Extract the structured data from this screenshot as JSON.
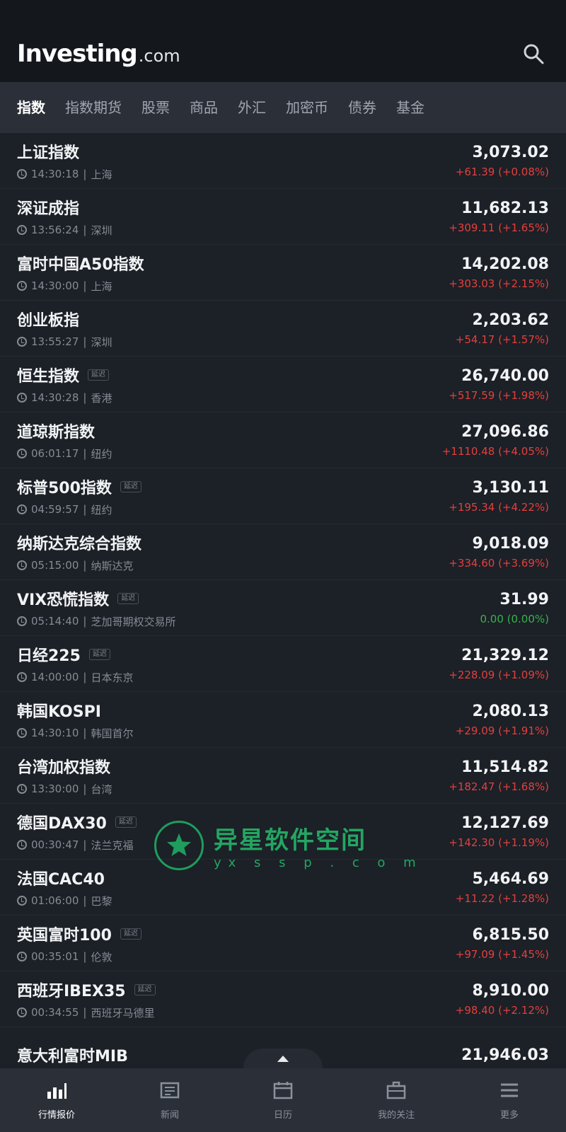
{
  "header": {
    "logo_main": "Investing",
    "logo_suffix": ".com"
  },
  "tabs": [
    {
      "label": "指数",
      "active": true
    },
    {
      "label": "指数期货",
      "active": false
    },
    {
      "label": "股票",
      "active": false
    },
    {
      "label": "商品",
      "active": false
    },
    {
      "label": "外汇",
      "active": false
    },
    {
      "label": "加密币",
      "active": false
    },
    {
      "label": "债券",
      "active": false
    },
    {
      "label": "基金",
      "active": false
    }
  ],
  "quotes": [
    {
      "name": "上证指数",
      "badge": "",
      "time": "14:30:18",
      "exchange": "上海",
      "price": "3,073.02",
      "change": "+61.39 (+0.08%)",
      "direction": "up"
    },
    {
      "name": "深证成指",
      "badge": "",
      "time": "13:56:24",
      "exchange": "深圳",
      "price": "11,682.13",
      "change": "+309.11 (+1.65%)",
      "direction": "up"
    },
    {
      "name": "富时中国A50指数",
      "badge": "",
      "time": "14:30:00",
      "exchange": "上海",
      "price": "14,202.08",
      "change": "+303.03 (+2.15%)",
      "direction": "up"
    },
    {
      "name": "创业板指",
      "badge": "",
      "time": "13:55:27",
      "exchange": "深圳",
      "price": "2,203.62",
      "change": "+54.17 (+1.57%)",
      "direction": "up"
    },
    {
      "name": "恒生指数",
      "badge": "延迟",
      "time": "14:30:28",
      "exchange": "香港",
      "price": "26,740.00",
      "change": "+517.59 (+1.98%)",
      "direction": "up"
    },
    {
      "name": "道琼斯指数",
      "badge": "",
      "time": "06:01:17",
      "exchange": "纽约",
      "price": "27,096.86",
      "change": "+1110.48 (+4.05%)",
      "direction": "up"
    },
    {
      "name": "标普500指数",
      "badge": "延迟",
      "time": "04:59:57",
      "exchange": "纽约",
      "price": "3,130.11",
      "change": "+195.34 (+4.22%)",
      "direction": "up"
    },
    {
      "name": "纳斯达克综合指数",
      "badge": "",
      "time": "05:15:00",
      "exchange": "纳斯达克",
      "price": "9,018.09",
      "change": "+334.60 (+3.69%)",
      "direction": "up"
    },
    {
      "name": "VIX恐慌指数",
      "badge": "延迟",
      "time": "05:14:40",
      "exchange": "芝加哥期权交易所",
      "price": "31.99",
      "change": "0.00 (0.00%)",
      "direction": "flat"
    },
    {
      "name": "日经225",
      "badge": "延迟",
      "time": "14:00:00",
      "exchange": "日本东京",
      "price": "21,329.12",
      "change": "+228.09 (+1.09%)",
      "direction": "up"
    },
    {
      "name": "韩国KOSPI",
      "badge": "",
      "time": "14:30:10",
      "exchange": "韩国首尔",
      "price": "2,080.13",
      "change": "+29.09 (+1.91%)",
      "direction": "up"
    },
    {
      "name": "台湾加权指数",
      "badge": "",
      "time": "13:30:00",
      "exchange": "台湾",
      "price": "11,514.82",
      "change": "+182.47 (+1.68%)",
      "direction": "up"
    },
    {
      "name": "德国DAX30",
      "badge": "延迟",
      "time": "00:30:47",
      "exchange": "法兰克福",
      "price": "12,127.69",
      "change": "+142.30 (+1.19%)",
      "direction": "up"
    },
    {
      "name": "法国CAC40",
      "badge": "",
      "time": "01:06:00",
      "exchange": "巴黎",
      "price": "5,464.69",
      "change": "+11.22 (+1.28%)",
      "direction": "up"
    },
    {
      "name": "英国富时100",
      "badge": "延迟",
      "time": "00:35:01",
      "exchange": "伦敦",
      "price": "6,815.50",
      "change": "+97.09 (+1.45%)",
      "direction": "up"
    },
    {
      "name": "西班牙IBEX35",
      "badge": "延迟",
      "time": "00:34:55",
      "exchange": "西班牙马德里",
      "price": "8,910.00",
      "change": "+98.40 (+2.12%)",
      "direction": "up"
    },
    {
      "name": "意大利富时MIB",
      "badge": "",
      "time": "",
      "exchange": "",
      "price": "21,946.03",
      "change": "",
      "direction": "up"
    }
  ],
  "watermark": {
    "cn": "异星软件空间",
    "en": "yx s s p . c o m"
  },
  "bottom_nav": [
    {
      "label": "行情报价",
      "icon": "bar-chart-icon",
      "active": true
    },
    {
      "label": "新闻",
      "icon": "news-icon",
      "active": false
    },
    {
      "label": "日历",
      "icon": "calendar-icon",
      "active": false
    },
    {
      "label": "我的关注",
      "icon": "briefcase-icon",
      "active": false
    },
    {
      "label": "更多",
      "icon": "menu-icon",
      "active": false
    }
  ],
  "colors": {
    "up": "#e2403d",
    "flat": "#35b44a",
    "background": "#1c2027",
    "header": "#14171c"
  }
}
